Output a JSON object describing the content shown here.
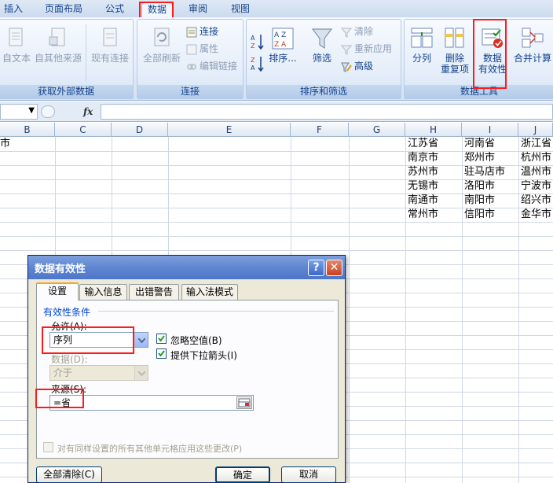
{
  "ribbon_tabs": [
    "插入",
    "页面布局",
    "公式",
    "数据",
    "审阅",
    "视图"
  ],
  "active_tab": "数据",
  "groups": {
    "get_external": {
      "label": "获取外部数据",
      "buttons": {
        "from_text": "自文本",
        "from_other": "自其他来源",
        "existing": "现有连接"
      }
    },
    "connections": {
      "label": "连接",
      "refresh_all": "全部刷新",
      "connections": "连接",
      "properties": "属性",
      "edit_links": "编辑链接"
    },
    "sort_filter": {
      "label": "排序和筛选",
      "sort": "排序...",
      "filter": "筛选",
      "clear": "清除",
      "reapply": "重新应用",
      "advanced": "高级"
    },
    "data_tools": {
      "label": "数据工具",
      "text_to_columns": "分列",
      "remove_duplicates_1": "删除",
      "remove_duplicates_2": "重复项",
      "validation_1": "数据",
      "validation_2": "有效性",
      "consolidate": "合并计算"
    }
  },
  "formula_bar": {
    "fx": "fx"
  },
  "columns": [
    "B",
    "C",
    "D",
    "E",
    "F",
    "G",
    "H",
    "I",
    "J"
  ],
  "cells": {
    "b1": "市",
    "col_h": [
      "江苏省",
      "南京市",
      "苏州市",
      "无锡市",
      "南通市",
      "常州市"
    ],
    "col_i": [
      "河南省",
      "郑州市",
      "驻马店市",
      "洛阳市",
      "南阳市",
      "信阳市"
    ],
    "col_j": [
      "浙江省",
      "杭州市",
      "温州市",
      "宁波市",
      "绍兴市",
      "金华市"
    ]
  },
  "dialog": {
    "title": "数据有效性",
    "help": "?",
    "close": "✕",
    "tabs": [
      "设置",
      "输入信息",
      "出错警告",
      "输入法模式"
    ],
    "section": "有效性条件",
    "allow_label": "允许(A):",
    "allow_value": "序列",
    "data_label": "数据(D):",
    "data_value": "介于",
    "ignore_blank": "忽略空值(B)",
    "dropdown": "提供下拉箭头(I)",
    "source_label": "来源(S):",
    "source_value": "=省",
    "apply_all": "对有同样设置的所有其他单元格应用这些更改(P)",
    "clear_all": "全部清除(C)",
    "ok": "确定",
    "cancel": "取消"
  }
}
